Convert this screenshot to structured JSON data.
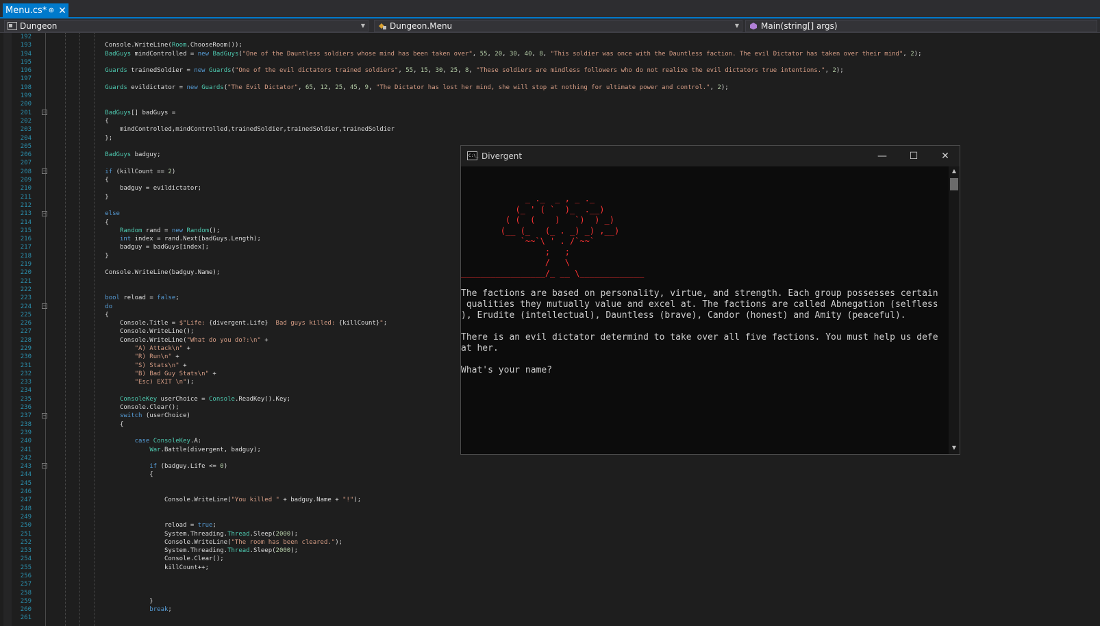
{
  "tab": {
    "label": "Menu.cs*",
    "pin_glyph": "⊕",
    "close_glyph": "✕"
  },
  "navbar": {
    "project": "Dungeon",
    "class": "Dungeon.Menu",
    "member": "Main(string[] args)",
    "dropdown_glyph": "▼"
  },
  "editor": {
    "line_numbers": [
      "192",
      "193",
      "194",
      "195",
      "196",
      "197",
      "198",
      "199",
      "200",
      "201",
      "202",
      "203",
      "204",
      "205",
      "206",
      "207",
      "208",
      "209",
      "210",
      "211",
      "212",
      "213",
      "214",
      "215",
      "216",
      "217",
      "218",
      "219",
      "220",
      "221",
      "222",
      "223",
      "224",
      "225",
      "226",
      "227",
      "228",
      "229",
      "230",
      "231",
      "232",
      "233",
      "234",
      "235",
      "236",
      "237",
      "238",
      "239",
      "240",
      "241",
      "242",
      "243",
      "244",
      "245",
      "246",
      "247",
      "248",
      "249",
      "250",
      "251",
      "252",
      "253",
      "254",
      "255",
      "256",
      "257",
      "258",
      "259",
      "260",
      "261"
    ],
    "fold_glyph": "−"
  },
  "console": {
    "title": "Divergent",
    "icon_label": "C:\\_",
    "minimize_glyph": "—",
    "maximize_glyph": "☐",
    "close_glyph": "✕",
    "ascii_art": "             _ ._  _ , _ ._\n           (_ ' ( `  )_  .__)\n         ( (  (    )   `)  ) _)\n        (__ (_   (_ . _) _) ,__)\n            `~~`\\ ' . /`~~`\n                 ;   ;\n                 /   \\\n_________________/_ __ \\_____________",
    "text_lines": [
      "The factions are based on personality, virtue, and strength. Each group possesses certain",
      " qualities they mutually value and excel at. The factions are called Abnegation (selfless",
      "), Erudite (intellectual), Dauntless (brave), Candor (honest) and Amity (peaceful).",
      "There is an evil dictator determind to take over all five factions. You must help us defe",
      "at her.",
      "What's your name?"
    ],
    "scroll_up_glyph": "▲",
    "scroll_down_glyph": "▼"
  }
}
